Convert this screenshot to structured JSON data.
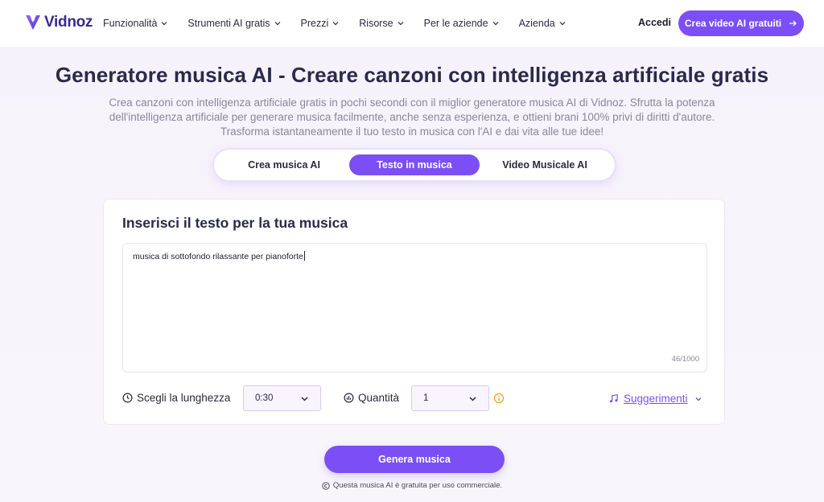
{
  "brand": {
    "name": "Vidnoz",
    "accent": "#7b4ff5"
  },
  "nav": {
    "items": [
      {
        "label": "Funzionalità"
      },
      {
        "label": "Strumenti AI gratis"
      },
      {
        "label": "Prezzi"
      },
      {
        "label": "Risorse"
      },
      {
        "label": "Per le aziende"
      },
      {
        "label": "Azienda"
      }
    ],
    "login_label": "Accedi",
    "cta_label": "Crea video AI gratuiti"
  },
  "hero": {
    "title": "Generatore musica AI - Creare canzoni con intelligenza artificiale gratis",
    "subtitle": "Crea canzoni con intelligenza artificiale gratis in pochi secondi con il miglior generatore musica AI di Vidnoz. Sfrutta la potenza dell'intelligenza artificiale per generare musica facilmente, anche senza esperienza, e ottieni brani 100% privi di diritti d'autore. Trasforma istantaneamente il tuo testo in musica con l'AI e dai vita alle tue idee!"
  },
  "tabs": [
    {
      "label": "Crea musica AI",
      "active": false
    },
    {
      "label": "Testo in musica",
      "active": true
    },
    {
      "label": "Video Musicale AI",
      "active": false
    }
  ],
  "form": {
    "title": "Inserisci il testo per la tua musica",
    "text_value": "musica di sottofondo rilassante per pianoforte",
    "counter": "46/1000",
    "length_label": "Scegli la lunghezza",
    "length_value": "0:30",
    "quantity_label": "Quantità",
    "quantity_value": "1",
    "suggestions_label": "Suggerimenti"
  },
  "generate_label": "Genera musica",
  "footnote": "Questa musica AI è gratuita per uso commerciale."
}
